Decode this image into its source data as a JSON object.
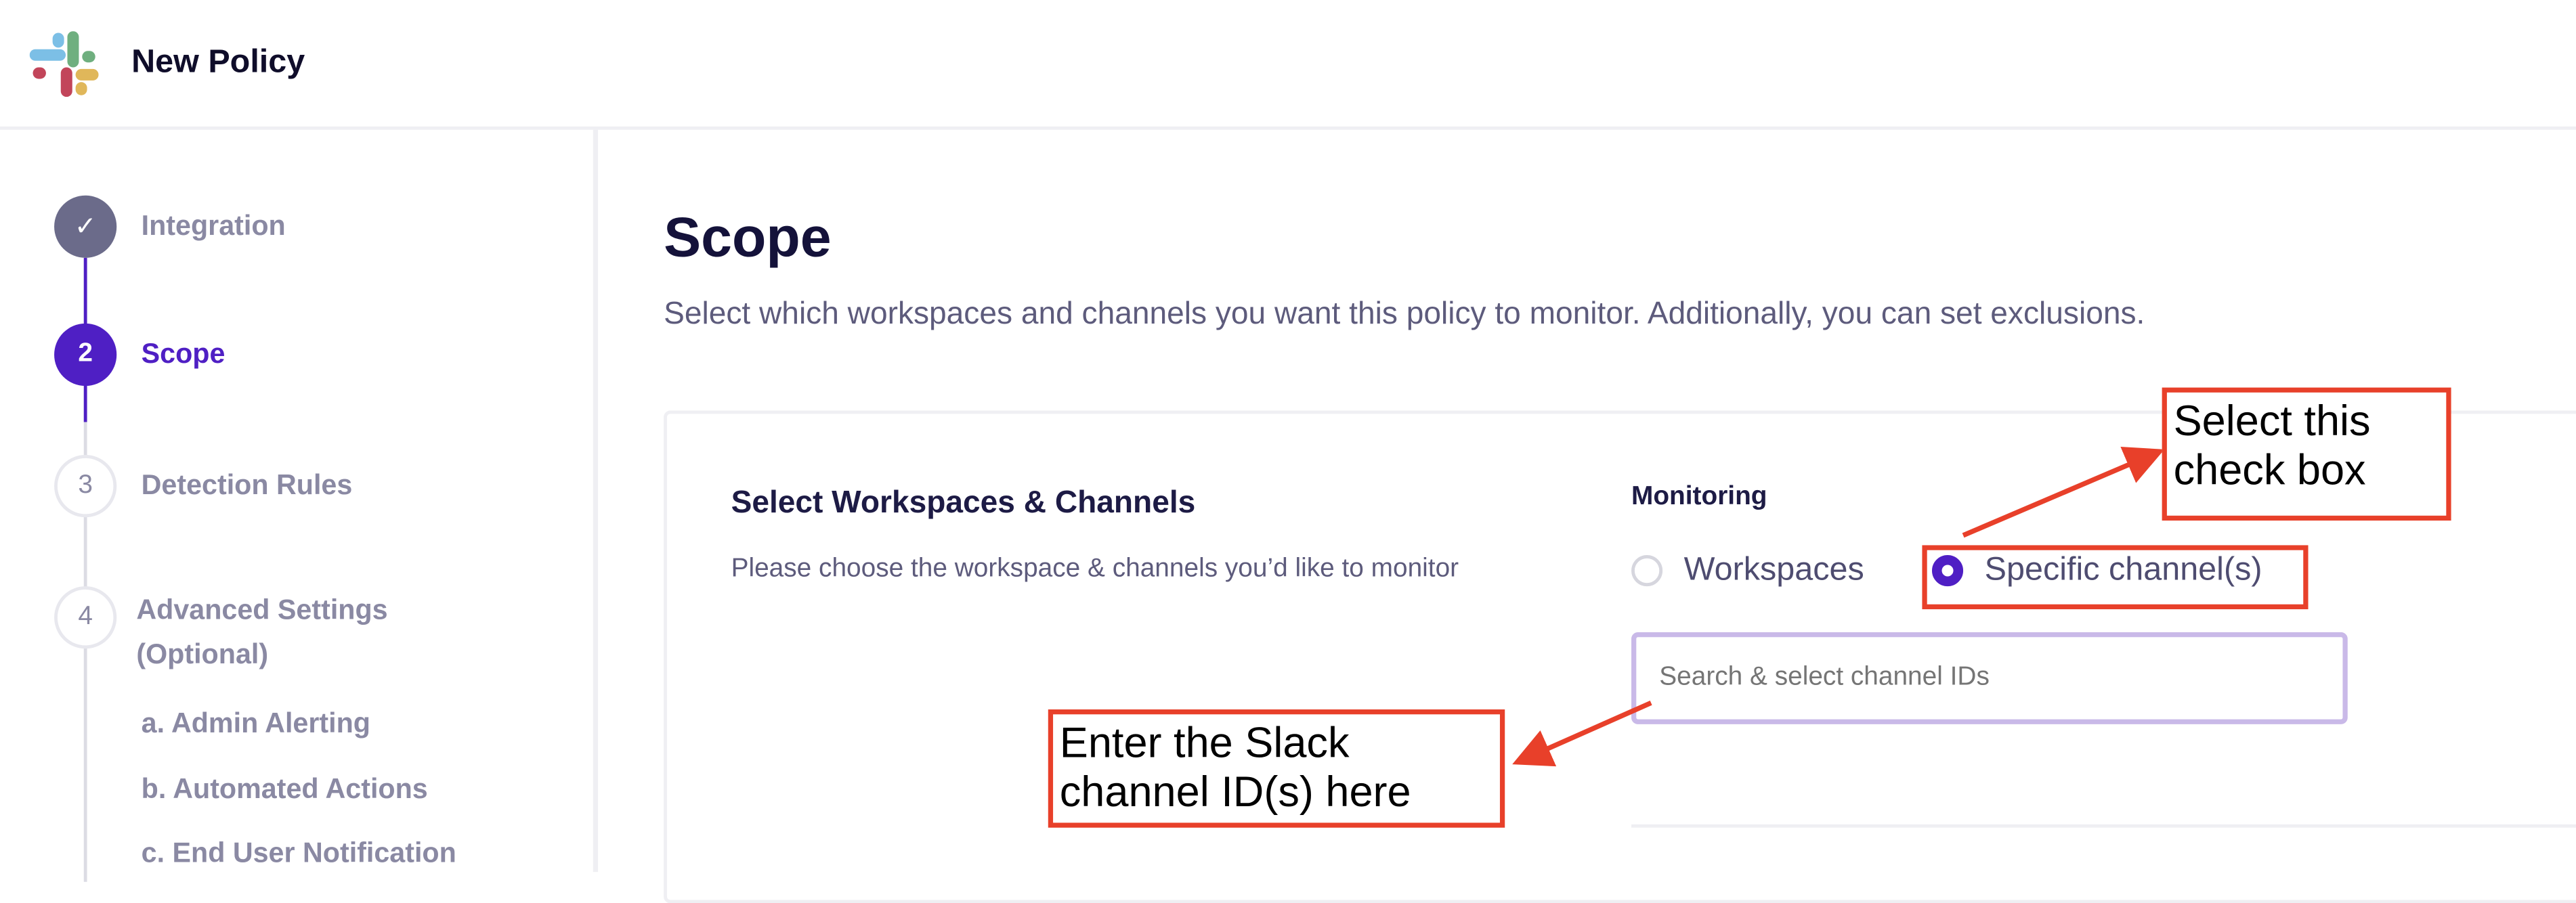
{
  "header": {
    "title": "New Policy",
    "logo": "slack-logo"
  },
  "steps": [
    {
      "label": "Integration",
      "marker": "✓",
      "state": "done"
    },
    {
      "label": "Scope",
      "marker": "2",
      "state": "active"
    },
    {
      "label": "Detection Rules",
      "marker": "3",
      "state": "pending"
    },
    {
      "label": "Advanced Settings (Optional)",
      "marker": "4",
      "state": "pending"
    }
  ],
  "substeps": [
    "a. Admin Alerting",
    "b. Automated Actions",
    "c. End User Notification"
  ],
  "main": {
    "title": "Scope",
    "description": "Select which workspaces and channels you want this policy to monitor. Additionally, you can set exclusions.",
    "section_title": "Select Workspaces & Channels",
    "section_desc": "Please choose the workspace & channels you’d like to monitor",
    "monitoring_label": "Monitoring",
    "options": [
      {
        "label": "Workspaces",
        "selected": false
      },
      {
        "label": "Specific channel(s)",
        "selected": true
      }
    ],
    "search_placeholder": "Search & select channel IDs"
  },
  "annotations": {
    "select": "Select this check box",
    "enter": "Enter the Slack channel ID(s) here"
  },
  "colors": {
    "accent": "#4f1fc4",
    "done": "#6b6b8a",
    "annotation": "#e8402a",
    "input_border": "#c9b9e8"
  }
}
